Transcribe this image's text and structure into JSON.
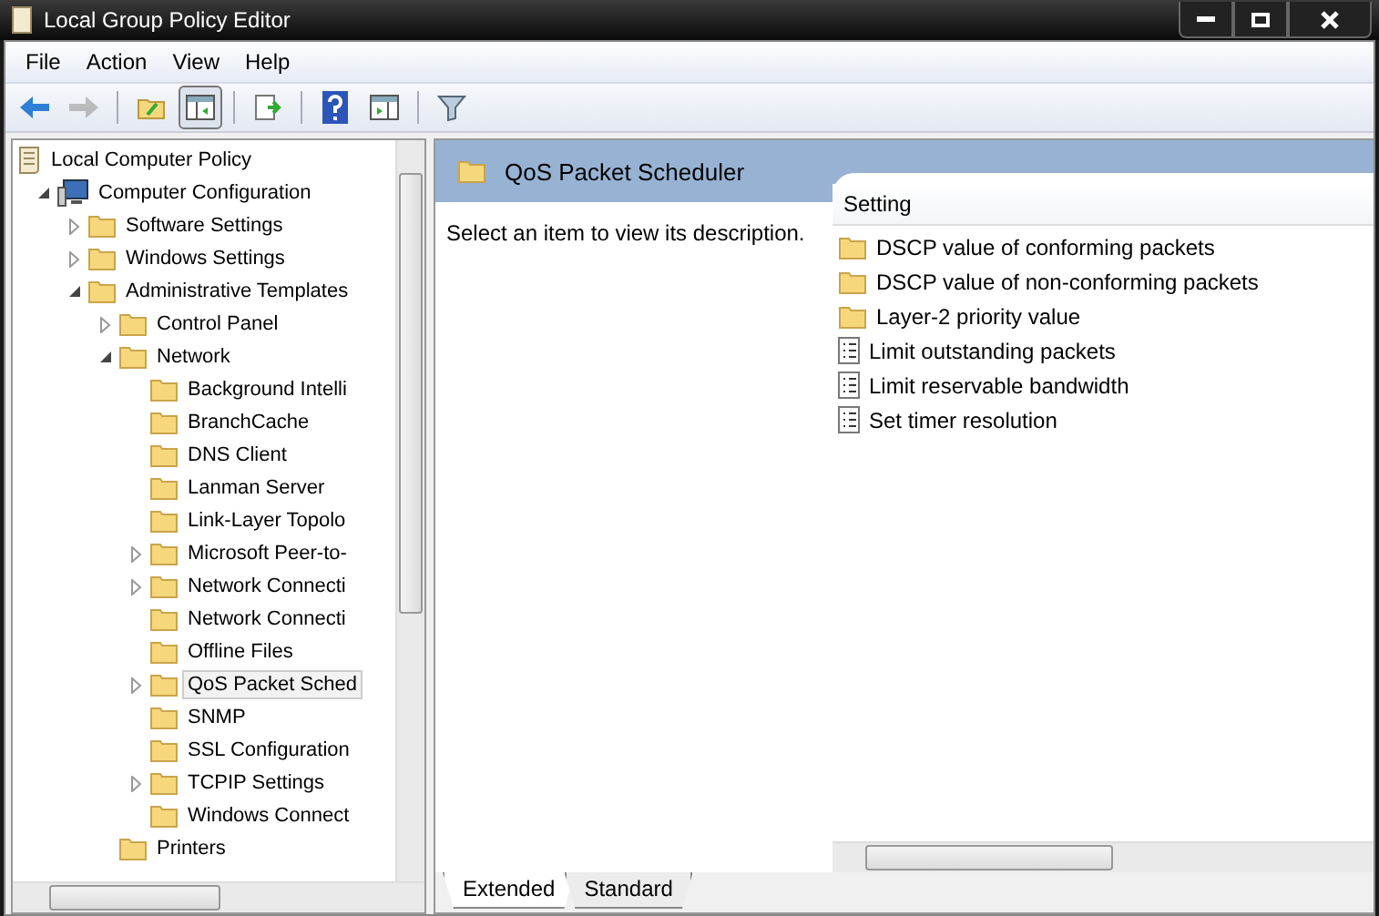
{
  "window": {
    "title": "Local Group Policy Editor"
  },
  "menu": [
    "File",
    "Action",
    "View",
    "Help"
  ],
  "toolbar": [
    {
      "kind": "back",
      "disabled": false
    },
    {
      "kind": "forward",
      "disabled": true
    },
    {
      "kind": "sep"
    },
    {
      "kind": "up",
      "disabled": false
    },
    {
      "kind": "tree",
      "disabled": false,
      "selected": true
    },
    {
      "kind": "sep"
    },
    {
      "kind": "export",
      "disabled": false
    },
    {
      "kind": "sep"
    },
    {
      "kind": "help",
      "disabled": false
    },
    {
      "kind": "pane",
      "disabled": false
    },
    {
      "kind": "sep"
    },
    {
      "kind": "filter",
      "disabled": false
    }
  ],
  "tree": [
    {
      "label": "Local Computer Policy",
      "selected": false,
      "children": [
        {
          "label": "Computer Configuration",
          "expanded": true,
          "selected": false,
          "children": [
            {
              "label": "Software Settings",
              "expanded": false,
              "selected": false
            },
            {
              "label": "Windows Settings",
              "expanded": false,
              "selected": false
            },
            {
              "label": "Administrative Templates",
              "expanded": true,
              "selected": false,
              "children": [
                {
                  "label": "Control Panel",
                  "expanded": false,
                  "selected": false
                },
                {
                  "label": "Network",
                  "expanded": true,
                  "selected": false,
                  "children": [
                    {
                      "label": "Background Intelli",
                      "selected": false
                    },
                    {
                      "label": "BranchCache",
                      "selected": false
                    },
                    {
                      "label": "DNS Client",
                      "selected": false
                    },
                    {
                      "label": "Lanman Server",
                      "selected": false
                    },
                    {
                      "label": "Link-Layer Topolo",
                      "selected": false
                    },
                    {
                      "label": "Microsoft Peer-to-",
                      "expanded": false,
                      "selected": false
                    },
                    {
                      "label": "Network Connecti",
                      "expanded": false,
                      "selected": false
                    },
                    {
                      "label": "Network Connecti",
                      "selected": false
                    },
                    {
                      "label": "Offline Files",
                      "selected": false
                    },
                    {
                      "label": "QoS Packet Sched",
                      "expanded": false,
                      "selected": true
                    },
                    {
                      "label": "SNMP",
                      "selected": false
                    },
                    {
                      "label": "SSL Configuration",
                      "selected": false
                    },
                    {
                      "label": "TCPIP Settings",
                      "expanded": false,
                      "selected": false
                    },
                    {
                      "label": "Windows Connect",
                      "selected": false
                    }
                  ]
                },
                {
                  "label": "Printers",
                  "selected": false
                }
              ]
            }
          ]
        }
      ]
    }
  ],
  "details": {
    "title": "QoS Packet Scheduler",
    "description": "Select an item to view its description.",
    "column": "Setting",
    "items": [
      {
        "label": "DSCP value of conforming packets",
        "kind": "folder"
      },
      {
        "label": "DSCP value of non-conforming packets",
        "kind": "folder"
      },
      {
        "label": "Layer-2 priority value",
        "kind": "folder"
      },
      {
        "label": "Limit outstanding packets",
        "kind": "setting"
      },
      {
        "label": "Limit reservable bandwidth",
        "kind": "setting"
      },
      {
        "label": "Set timer resolution",
        "kind": "setting"
      }
    ]
  },
  "view_tabs": [
    {
      "label": "Extended",
      "selected": true
    },
    {
      "label": "Standard",
      "selected": false
    }
  ]
}
